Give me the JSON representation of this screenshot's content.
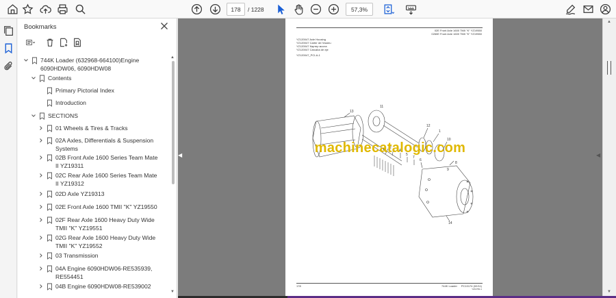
{
  "toolbar": {
    "current_page": "178",
    "total_pages": "/ 1228",
    "zoom": "57,3%"
  },
  "panel": {
    "title": "Bookmarks"
  },
  "bookmarks": [
    {
      "label": "744K Loader (632968-664100)Engine 6090HDW06, 6090HDW08",
      "expanded": true
    },
    {
      "label": "Contents",
      "expanded": true
    },
    {
      "label": "Primary Pictorial Index"
    },
    {
      "label": "Introduction"
    },
    {
      "label": "SECTIONS",
      "expanded": true
    },
    {
      "label": "01 Wheels & Tires & Tracks"
    },
    {
      "label": "02A Axles, Differentials & Suspension Systems"
    },
    {
      "label": "02B Front Axle 1600 Series Team Mate II YZ19311"
    },
    {
      "label": "02C Rear Axle 1600 Series Team Mate II YZ19312"
    },
    {
      "label": "02D Axle YZ19313"
    },
    {
      "label": "02E Front Axle 1600 TMII \"K\" YZ19550"
    },
    {
      "label": "02F Rear Axle 1600 Heavy Duty Wide TMII \"K\" YZ19551"
    },
    {
      "label": "02G Rear Axle 1600 Heavy Duty Wide TMII \"K\" YZ19552"
    },
    {
      "label": "03 Transmission"
    },
    {
      "label": "04A Engine 6090HDW06-RE535939, RE554451"
    },
    {
      "label": "04B Engine 6090HDW08-RE539002"
    }
  ],
  "document": {
    "header_right_1": "02E Front Axle 1600 TMII \"K\" YZ19550",
    "header_right_2": "0260E Front Axle 1600 TMII \"K\" YZ19550",
    "header_left_1": "YZ120047 Axle Housing",
    "header_left_2": "YZ120047 Carter de l'essieu",
    "header_left_3": "YZ120047 Карт­ер моста",
    "header_left_4": "YZ120047 Cárcaba de eje",
    "figure_ref": "YZ120047_PCI-A-1",
    "footer_page": "178",
    "footer_model": "744K Loader",
    "footer_code": "PC10174 (02/11)",
    "footer_sub": "YZ19750-1",
    "callouts": [
      "13",
      "11",
      "12",
      "1",
      "10",
      "3",
      "2",
      "4",
      "5",
      "7",
      "6",
      "8",
      "9",
      "14"
    ],
    "watermark": "machinecatalogic.com"
  }
}
